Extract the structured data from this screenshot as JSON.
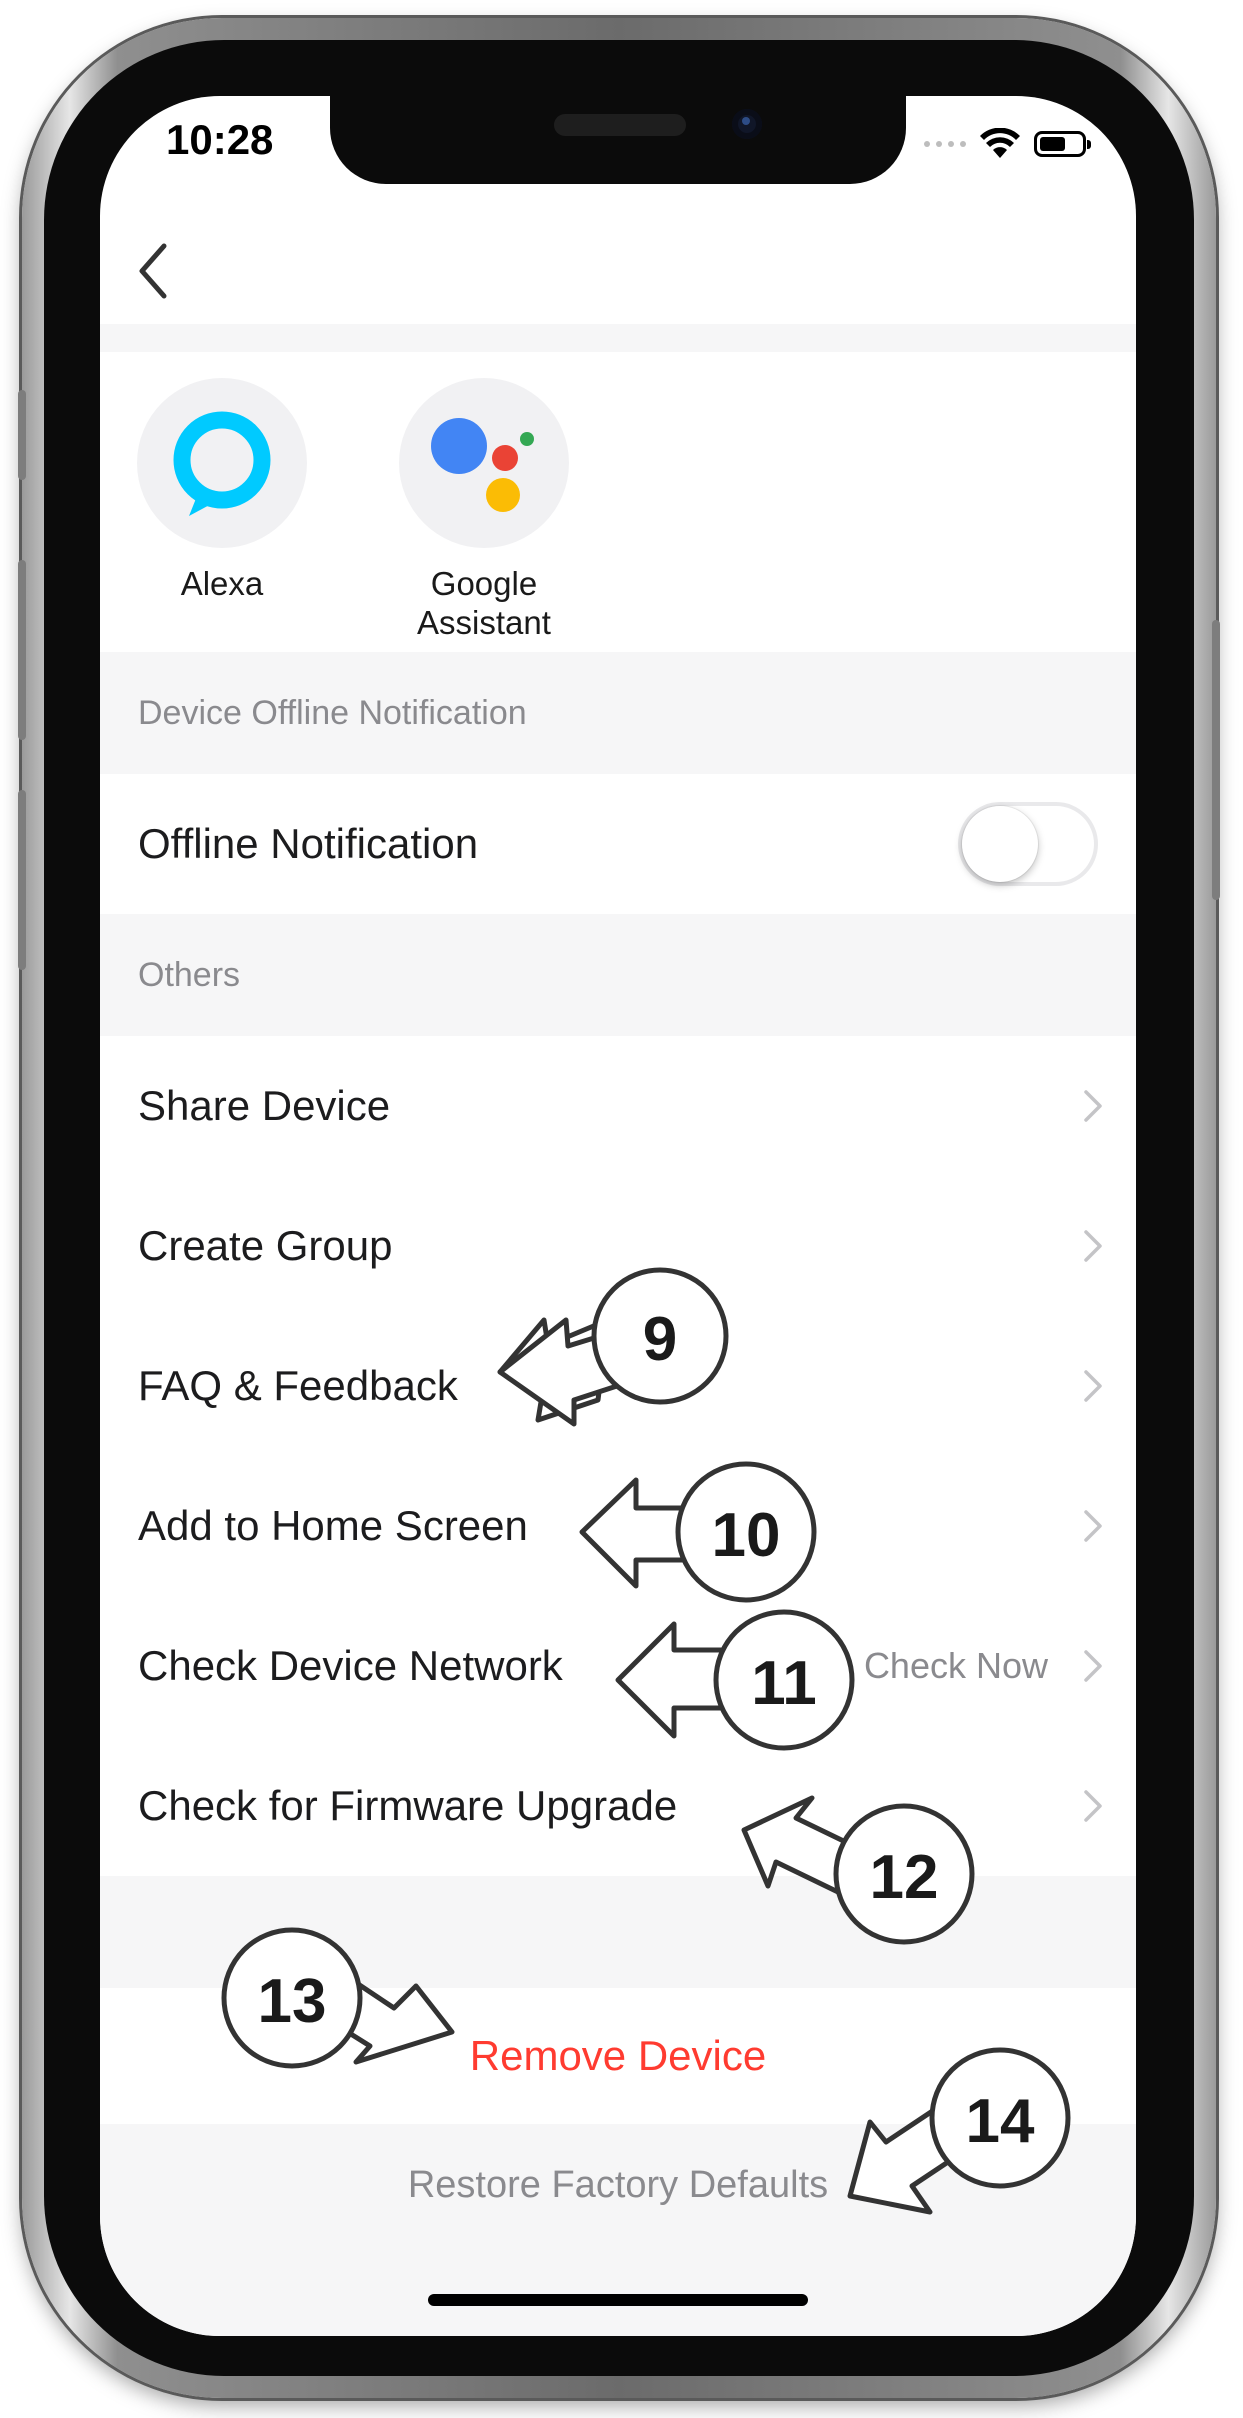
{
  "status_bar": {
    "time": "10:28"
  },
  "assistants": [
    {
      "label_line1": "Alexa",
      "label_line2": "",
      "icon": "alexa-icon"
    },
    {
      "label_line1": "Google",
      "label_line2": "Assistant",
      "icon": "google-assistant-icon"
    }
  ],
  "sections": {
    "offline_header": "Device Offline Notification",
    "others_header": "Others"
  },
  "offline_notification": {
    "label": "Offline Notification",
    "enabled": false
  },
  "menu": [
    {
      "label": "Share Device",
      "value": ""
    },
    {
      "label": "Create Group",
      "value": ""
    },
    {
      "label": "FAQ & Feedback",
      "value": ""
    },
    {
      "label": "Add to Home Screen",
      "value": ""
    },
    {
      "label": "Check Device Network",
      "value": "Check Now"
    },
    {
      "label": "Check for Firmware Upgrade",
      "value": ""
    }
  ],
  "actions": {
    "remove_device": "Remove Device",
    "restore_defaults": "Restore Factory Defaults"
  },
  "callouts": [
    "9",
    "10",
    "11",
    "12",
    "13",
    "14"
  ],
  "colors": {
    "destructive": "#ff3b30",
    "secondary_text": "#8a8a8e",
    "section_bg": "#f6f6f7",
    "alexa_blue": "#00caff",
    "google_blue": "#4285f4",
    "google_red": "#ea4335",
    "google_yellow": "#fbbc05",
    "google_green": "#34a853"
  }
}
